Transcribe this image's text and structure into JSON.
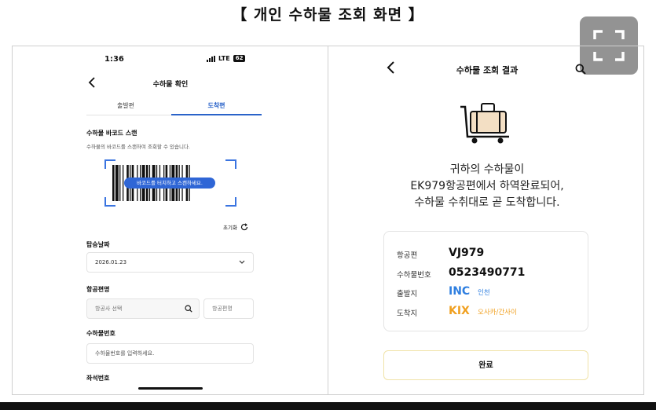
{
  "page_title": "【 개인 수하물 조회 화면 】",
  "left": {
    "status": {
      "time": "1:36",
      "network": "LTE",
      "battery": "62"
    },
    "header_title": "수하물 확인",
    "tabs": [
      {
        "label": "출발편",
        "active": false
      },
      {
        "label": "도착편",
        "active": true
      }
    ],
    "scan": {
      "title": "수하물 바코드 스캔",
      "help": "수하물의 바코드를 스캔하여 조회할 수 있습니다.",
      "button_label": "바코드를 터치하고 스캔하세요."
    },
    "reset_label": "초기화",
    "date": {
      "label": "탑승날짜",
      "value": "2026.01.23"
    },
    "flight": {
      "label": "항공편명",
      "airline_placeholder": "항공사 선택",
      "flight_placeholder": "항공편명"
    },
    "bag": {
      "label": "수하물번호",
      "placeholder": "수하물번호를 입력하세요."
    },
    "next_label": "좌석번호"
  },
  "right": {
    "header_title": "수하물 조회 결과",
    "message": [
      "귀하의 수하물이",
      "EK979항공편에서 하역완료되어,",
      "수하물 수취대로 곧 도착합니다."
    ],
    "details": {
      "flight_label": "항공편",
      "flight_value": "VJ979",
      "bag_label": "수하물번호",
      "bag_value": "0523490771",
      "origin_label": "출발지",
      "origin_code": "INC",
      "origin_city": "인천",
      "dest_label": "도착지",
      "dest_code": "KIX",
      "dest_city": "오사카/간사이"
    },
    "done_label": "완료"
  },
  "colors": {
    "accent": "#2a63c9",
    "origin": "#2f7fe0",
    "destination": "#f0a020"
  },
  "icons": [
    "chevron-left-icon",
    "search-icon",
    "refresh-icon",
    "chevron-down-icon",
    "luggage-cart-icon",
    "expand-icon"
  ]
}
